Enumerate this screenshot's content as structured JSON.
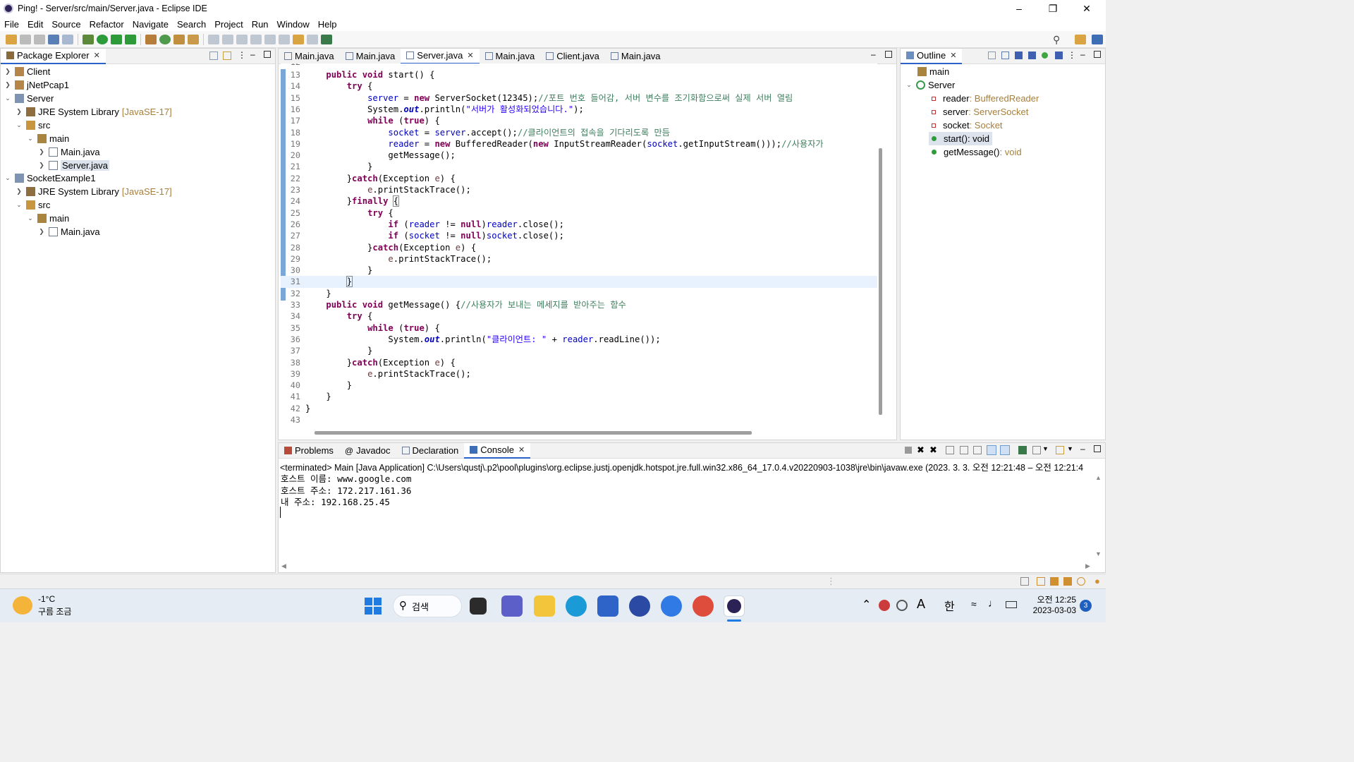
{
  "window": {
    "title": "Ping! - Server/src/main/Server.java - Eclipse IDE"
  },
  "menu": [
    "File",
    "Edit",
    "Source",
    "Refactor",
    "Navigate",
    "Search",
    "Project",
    "Run",
    "Window",
    "Help"
  ],
  "package_explorer": {
    "tab": "Package Explorer",
    "rows": [
      {
        "label": "Client",
        "decor": ""
      },
      {
        "label": "jNetPcap1",
        "decor": ""
      },
      {
        "label": "Server",
        "decor": ""
      },
      {
        "label": "JRE System Library",
        "decor": "[JavaSE-17]"
      },
      {
        "label": "src",
        "decor": ""
      },
      {
        "label": "main",
        "decor": ""
      },
      {
        "label": "Main.java",
        "decor": ""
      },
      {
        "label": "Server.java",
        "decor": ""
      },
      {
        "label": "SocketExample1",
        "decor": ""
      },
      {
        "label": "JRE System Library",
        "decor": "[JavaSE-17]"
      },
      {
        "label": "src",
        "decor": ""
      },
      {
        "label": "main",
        "decor": ""
      },
      {
        "label": "Main.java",
        "decor": ""
      }
    ]
  },
  "editor": {
    "tabs": [
      "Main.java",
      "Main.java",
      "Server.java",
      "Main.java",
      "Client.java",
      "Main.java"
    ],
    "active_tab": "Server.java",
    "partial_line_number": "12",
    "lines": [
      {
        "n": "13"
      },
      {
        "n": "14"
      },
      {
        "n": "15"
      },
      {
        "n": "16"
      },
      {
        "n": "17"
      },
      {
        "n": "18"
      },
      {
        "n": "19"
      },
      {
        "n": "20"
      },
      {
        "n": "21"
      },
      {
        "n": "22"
      },
      {
        "n": "23"
      },
      {
        "n": "24"
      },
      {
        "n": "25"
      },
      {
        "n": "26"
      },
      {
        "n": "27"
      },
      {
        "n": "28"
      },
      {
        "n": "29"
      },
      {
        "n": "30"
      },
      {
        "n": "31"
      },
      {
        "n": "32"
      },
      {
        "n": "33"
      },
      {
        "n": "34"
      },
      {
        "n": "35"
      },
      {
        "n": "36"
      },
      {
        "n": "37"
      },
      {
        "n": "38"
      },
      {
        "n": "39"
      },
      {
        "n": "40"
      },
      {
        "n": "41"
      },
      {
        "n": "42"
      },
      {
        "n": "43"
      }
    ],
    "code_text": {
      "l13": [
        "public",
        " ",
        "void",
        " start() {"
      ],
      "l15_comment": "//포트 번호 들어감, 서버 변수를 조기화함으로써 실제 서버 열림",
      "l16_string": "\"서버가 활성화되었습니다.\"",
      "l18_comment": "//클라이언트의 접속을 기다리도록 만듬",
      "l19_comment": "//사용자가",
      "l33_comment": "//사용자가 보내는 메세지를 받아주는 함수",
      "l36_string": "\"클라이언트: \""
    }
  },
  "outline": {
    "tab": "Outline",
    "items": [
      {
        "name": "main",
        "type": ""
      },
      {
        "name": "Server",
        "type": ""
      },
      {
        "name": "reader",
        "type": " : BufferedReader"
      },
      {
        "name": "server",
        "type": " : ServerSocket"
      },
      {
        "name": "socket",
        "type": " : Socket"
      },
      {
        "name": "start()",
        "type": " : void"
      },
      {
        "name": "getMessage()",
        "type": " : void"
      }
    ]
  },
  "bottom": {
    "tabs": [
      "Problems",
      "Javadoc",
      "Declaration",
      "Console"
    ],
    "active_tab": "Console",
    "status_line": "<terminated> Main [Java Application] C:\\Users\\qustj\\.p2\\pool\\plugins\\org.eclipse.justj.openjdk.hotspot.jre.full.win32.x86_64_17.0.4.v20220903-1038\\jre\\bin\\javaw.exe  (2023. 3. 3. 오전 12:21:48 – 오전 12:21:4",
    "output": [
      "호스트 이름: www.google.com",
      "호스트 주소: 172.217.161.36",
      "내 주소: 192.168.25.45"
    ]
  },
  "taskbar": {
    "weather_temp": "-1°C",
    "weather_desc": "구름 조금",
    "search_label": "검색",
    "ime": "한",
    "font_icon": "A",
    "clock_time": "오전 12:25",
    "clock_date": "2023-03-03",
    "notification_count": "3"
  },
  "colors": {
    "keyword": "#7f0055",
    "field": "#0000c0",
    "string": "#2a00ff",
    "comment": "#3f7f5f",
    "accent": "#2b62c9"
  }
}
